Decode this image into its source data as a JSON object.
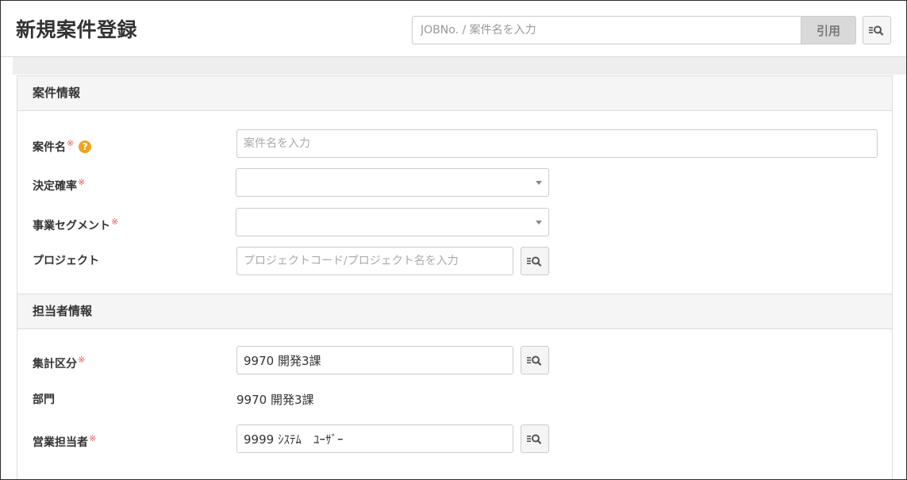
{
  "header": {
    "title": "新規案件登録",
    "search_placeholder": "JOBNo. / 案件名を入力",
    "cite_label": "引用"
  },
  "sections": {
    "case_info": {
      "title": "案件情報",
      "case_name": {
        "label": "案件名",
        "required_mark": "※",
        "help_glyph": "?",
        "placeholder": "案件名を入力"
      },
      "probability": {
        "label": "決定確率",
        "required_mark": "※"
      },
      "segment": {
        "label": "事業セグメント",
        "required_mark": "※"
      },
      "project": {
        "label": "プロジェクト",
        "placeholder": "プロジェクトコード/プロジェクト名を入力"
      }
    },
    "person_info": {
      "title": "担当者情報",
      "aggregation": {
        "label": "集計区分",
        "required_mark": "※",
        "value": "9970 開発3課"
      },
      "department": {
        "label": "部門",
        "value": "9970 開発3課"
      },
      "sales_rep": {
        "label": "営業担当者",
        "required_mark": "※",
        "value": "9999 ｼｽﾃﾑ　ﾕｰｻﾞｰ"
      }
    }
  },
  "icons": {
    "lookup": "list-search-icon",
    "dropdown": "caret-down-icon",
    "help": "question-circle-icon"
  },
  "colors": {
    "required": "#e05a5a",
    "help": "#f0a21c"
  }
}
